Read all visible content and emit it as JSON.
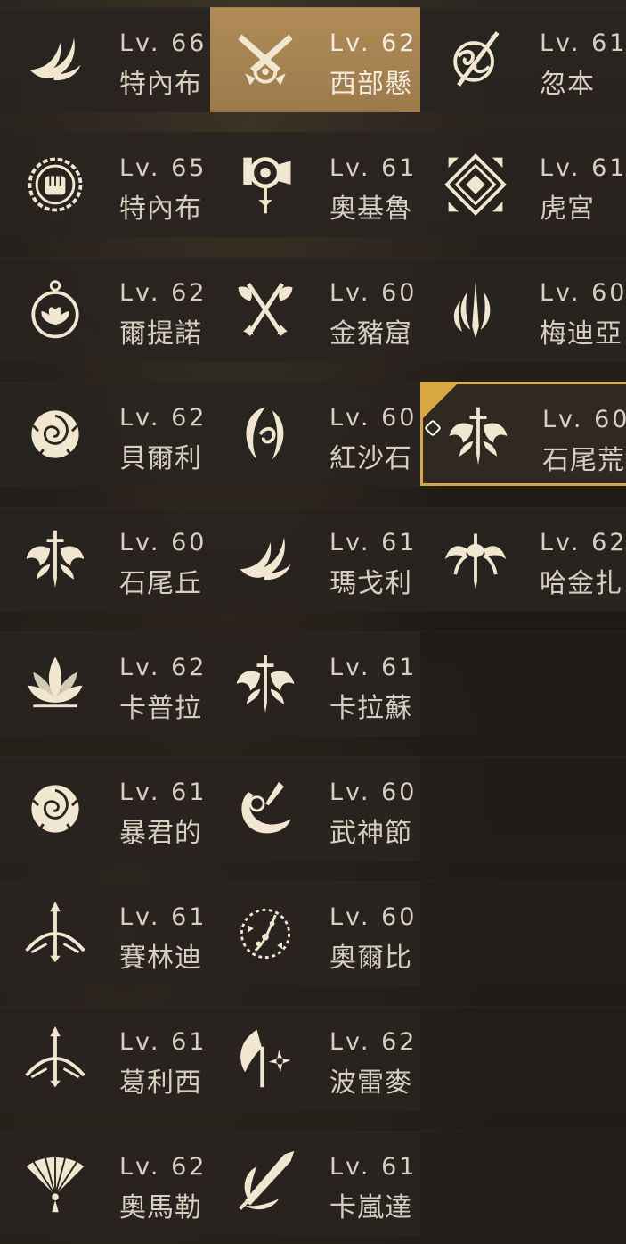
{
  "rows": [
    [
      {
        "level": "Lv. 66",
        "name": "特內布",
        "icon": "swallow-flame-icon"
      },
      {
        "level": "Lv. 62",
        "name": "西部懸",
        "icon": "crossed-revolvers-icon",
        "state": "gold"
      },
      {
        "level": "Lv. 61",
        "name": "忽本",
        "icon": "ornate-spear-ring-icon"
      }
    ],
    [
      {
        "level": "Lv. 65",
        "name": "特內布",
        "icon": "fist-emblem-icon"
      },
      {
        "level": "Lv. 61",
        "name": "奧基魯",
        "icon": "war-axe-icon"
      },
      {
        "level": "Lv. 61",
        "name": "虎宮",
        "icon": "nested-diamond-icon"
      }
    ],
    [
      {
        "level": "Lv. 62",
        "name": "爾提諾",
        "icon": "lotus-orb-icon"
      },
      {
        "level": "Lv. 60",
        "name": "金豬窟",
        "icon": "double-axe-icon"
      },
      {
        "level": "Lv. 60",
        "name": "梅迪亞",
        "icon": "flame-blade-icon"
      }
    ],
    [
      {
        "level": "Lv. 62",
        "name": "貝爾利",
        "icon": "rose-icon"
      },
      {
        "level": "Lv. 60",
        "name": "紅沙石",
        "icon": "crescent-swirl-icon"
      },
      {
        "level": "Lv. 60",
        "name": "石尾荒",
        "icon": "winged-sword-icon",
        "state": "border"
      }
    ],
    [
      {
        "level": "Lv. 60",
        "name": "石尾丘",
        "icon": "winged-sword-icon"
      },
      {
        "level": "Lv. 61",
        "name": "瑪戈利",
        "icon": "swallow-flame-icon"
      },
      {
        "level": "Lv. 62",
        "name": "哈金扎",
        "icon": "spider-sword-icon"
      }
    ],
    [
      {
        "level": "Lv. 62",
        "name": "卡普拉",
        "icon": "lotus-icon"
      },
      {
        "level": "Lv. 61",
        "name": "卡拉蘇",
        "icon": "winged-sword-icon"
      },
      {
        "empty": true
      }
    ],
    [
      {
        "level": "Lv. 61",
        "name": "暴君的",
        "icon": "rose-icon"
      },
      {
        "level": "Lv. 60",
        "name": "武神節",
        "icon": "horn-dagger-icon"
      },
      {
        "empty": true
      }
    ],
    [
      {
        "level": "Lv. 61",
        "name": "賽林迪",
        "icon": "arrow-bow-icon"
      },
      {
        "level": "Lv. 60",
        "name": "奧爾比",
        "icon": "floral-wreath-icon"
      },
      {
        "empty": true
      }
    ],
    [
      {
        "level": "Lv. 61",
        "name": "葛利西",
        "icon": "arrow-bow-icon"
      },
      {
        "level": "Lv. 62",
        "name": "波雷麥",
        "icon": "star-axe-icon"
      },
      {
        "empty": true
      }
    ],
    [
      {
        "level": "Lv. 62",
        "name": "奧馬勒",
        "icon": "folding-fan-icon"
      },
      {
        "level": "Lv. 61",
        "name": "卡嵐達",
        "icon": "flaming-spear-icon"
      },
      {
        "empty": true
      }
    ]
  ],
  "colors": {
    "accent_gold": "#d7a940",
    "selected_fill": "#a8834f",
    "text": "#d7cec0",
    "icon": "#f1e6cf"
  }
}
